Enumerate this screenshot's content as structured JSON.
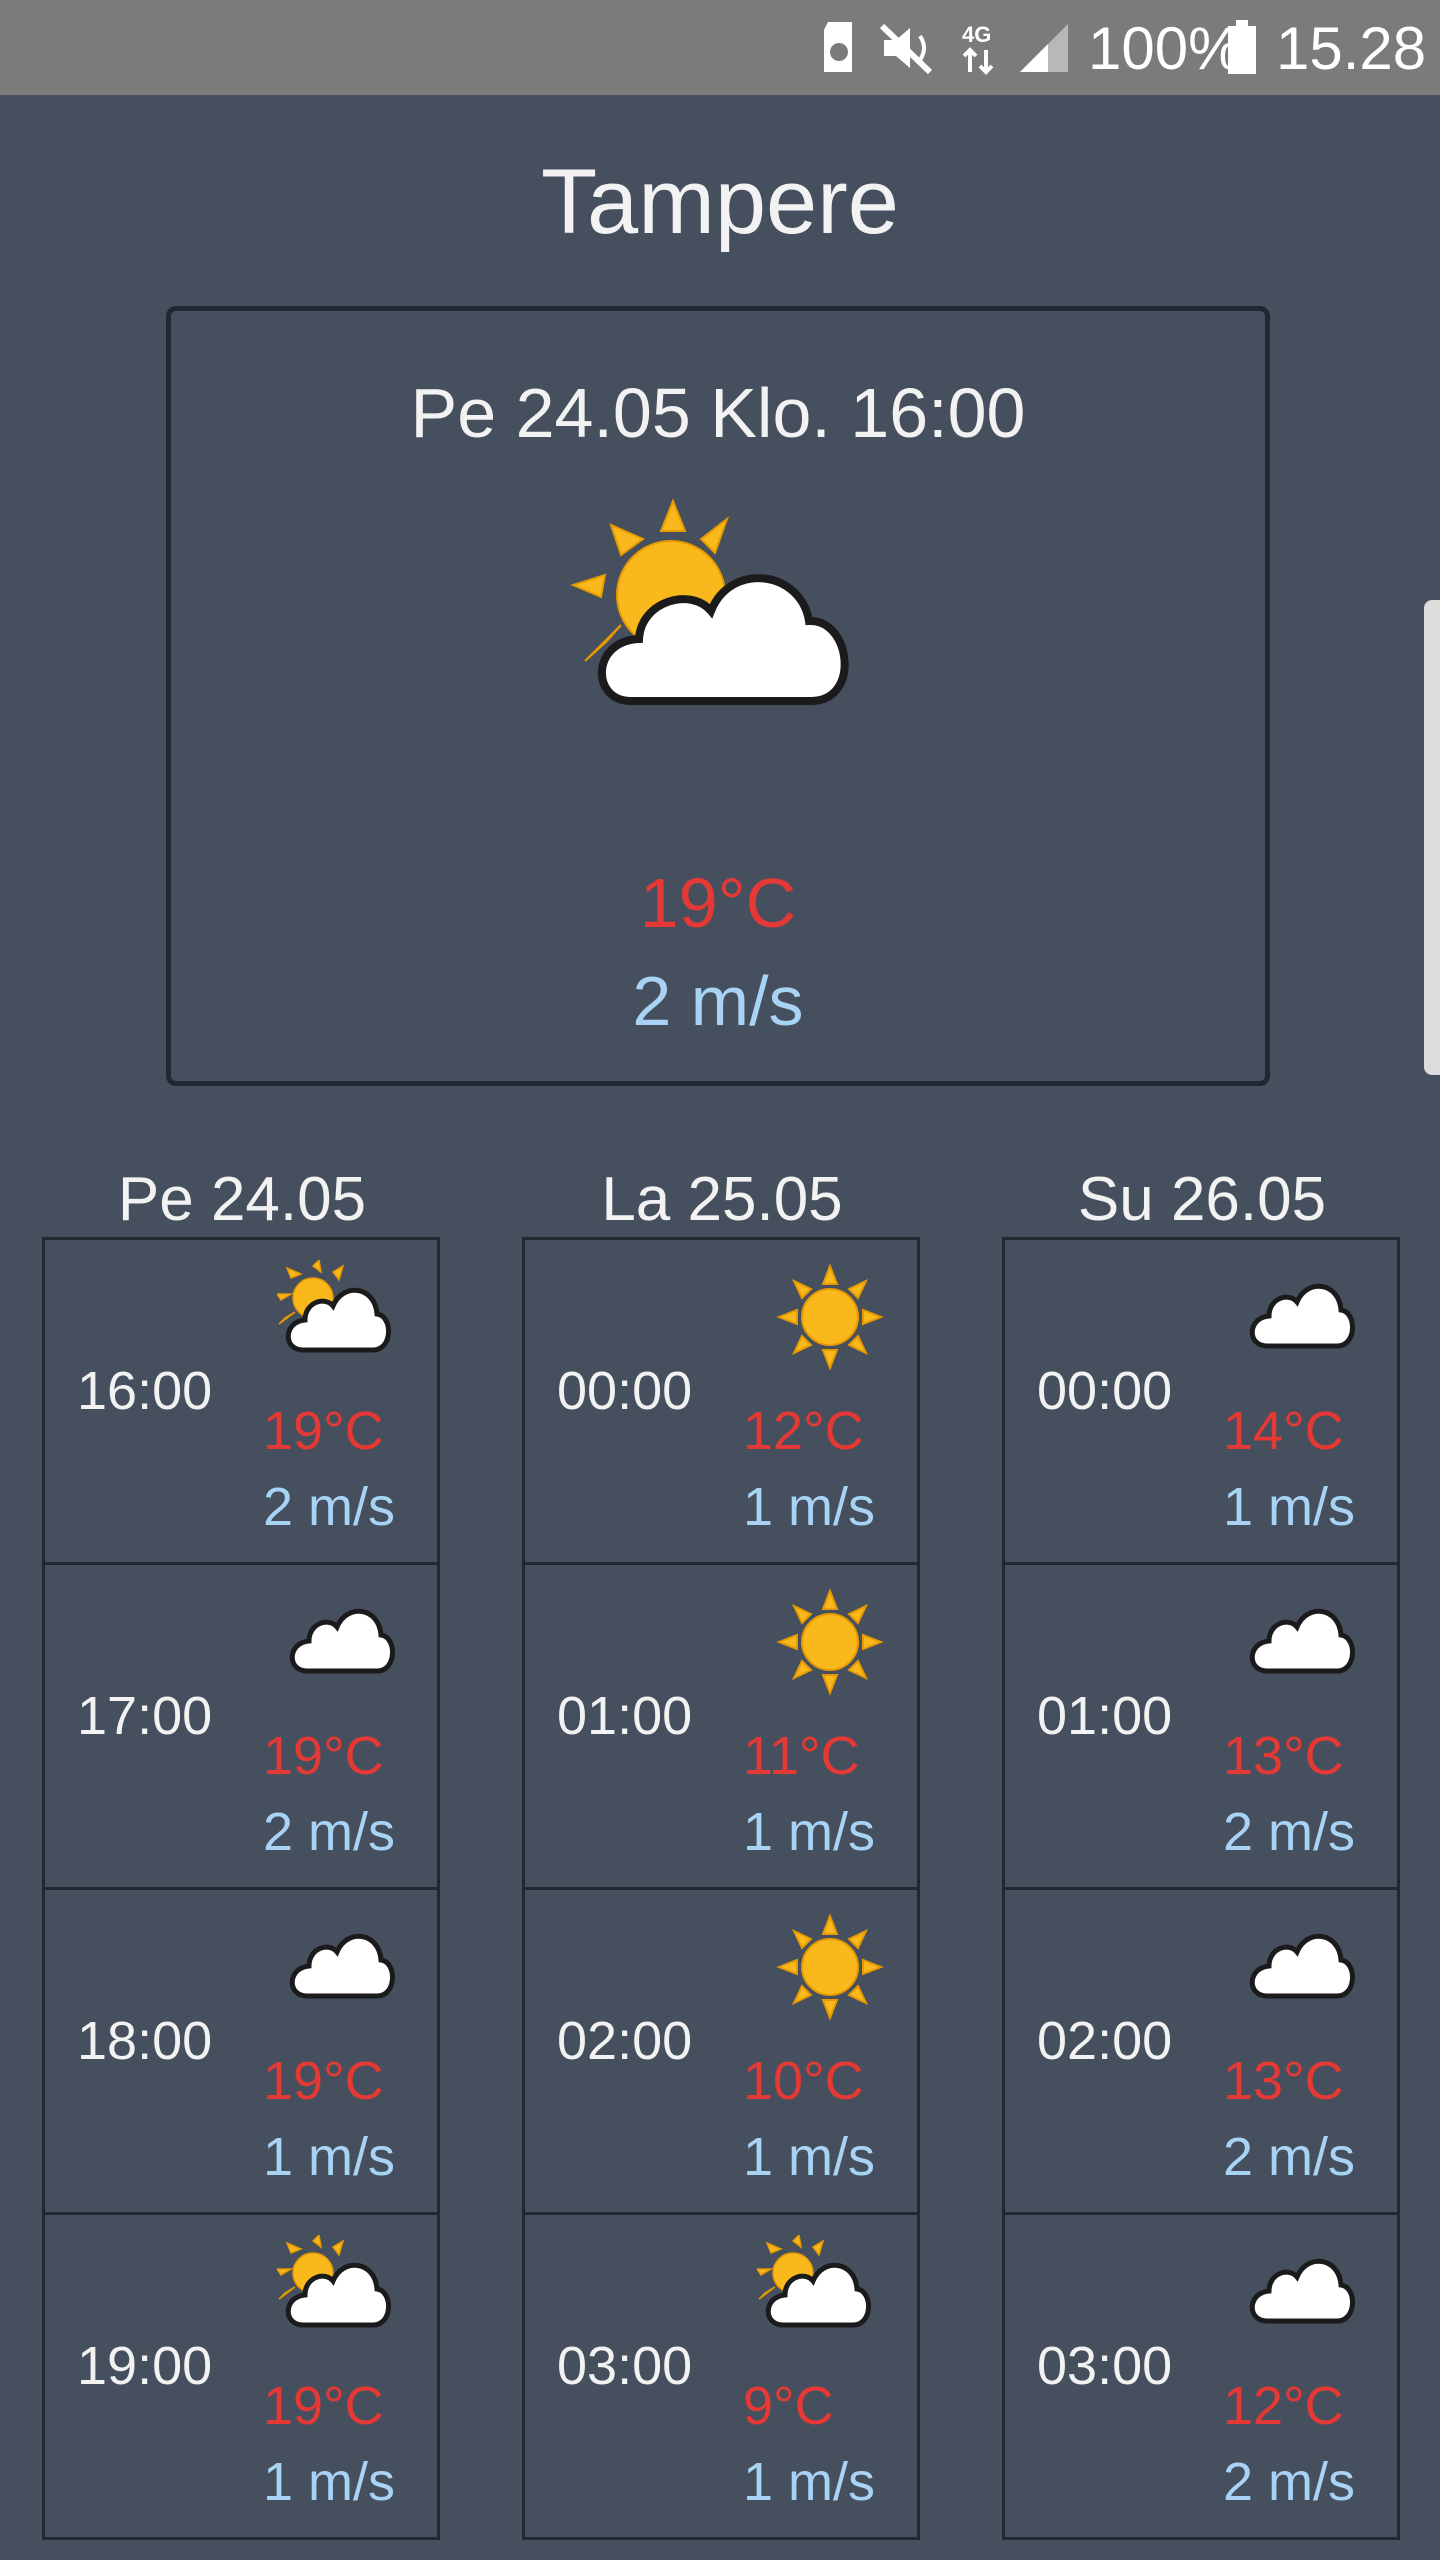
{
  "status_bar": {
    "battery_percent": "100%",
    "time": "15.28",
    "network": "4G",
    "icons": [
      "sd-card-icon",
      "mute-icon",
      "4g-icon",
      "signal-icon",
      "battery-icon"
    ]
  },
  "city": "Tampere",
  "current": {
    "datetime": "Pe 24.05 Klo. 16:00",
    "icon": "partly-cloudy-icon",
    "temperature": "19°C",
    "wind": "2 m/s"
  },
  "days": [
    {
      "label": "Pe 24.05",
      "hours": [
        {
          "time": "16:00",
          "icon": "partly-cloudy",
          "temp": "19°C",
          "wind": "2 m/s"
        },
        {
          "time": "17:00",
          "icon": "cloud",
          "temp": "19°C",
          "wind": "2 m/s"
        },
        {
          "time": "18:00",
          "icon": "cloud",
          "temp": "19°C",
          "wind": "1 m/s"
        },
        {
          "time": "19:00",
          "icon": "partly-cloudy",
          "temp": "19°C",
          "wind": "1 m/s"
        }
      ]
    },
    {
      "label": "La 25.05",
      "hours": [
        {
          "time": "00:00",
          "icon": "sun",
          "temp": "12°C",
          "wind": "1 m/s"
        },
        {
          "time": "01:00",
          "icon": "sun",
          "temp": "11°C",
          "wind": "1 m/s"
        },
        {
          "time": "02:00",
          "icon": "sun",
          "temp": "10°C",
          "wind": "1 m/s"
        },
        {
          "time": "03:00",
          "icon": "partly-cloudy",
          "temp": "9°C",
          "wind": "1 m/s"
        }
      ]
    },
    {
      "label": "Su 26.05",
      "hours": [
        {
          "time": "00:00",
          "icon": "cloud",
          "temp": "14°C",
          "wind": "1 m/s"
        },
        {
          "time": "01:00",
          "icon": "cloud",
          "temp": "13°C",
          "wind": "2 m/s"
        },
        {
          "time": "02:00",
          "icon": "cloud",
          "temp": "13°C",
          "wind": "2 m/s"
        },
        {
          "time": "03:00",
          "icon": "cloud",
          "temp": "12°C",
          "wind": "2 m/s"
        }
      ]
    }
  ],
  "colors": {
    "background": "#454f5d",
    "temperature": "#e53935",
    "wind": "#a8d3f5",
    "border": "#22282f",
    "status_bar": "#7b7b7b"
  }
}
